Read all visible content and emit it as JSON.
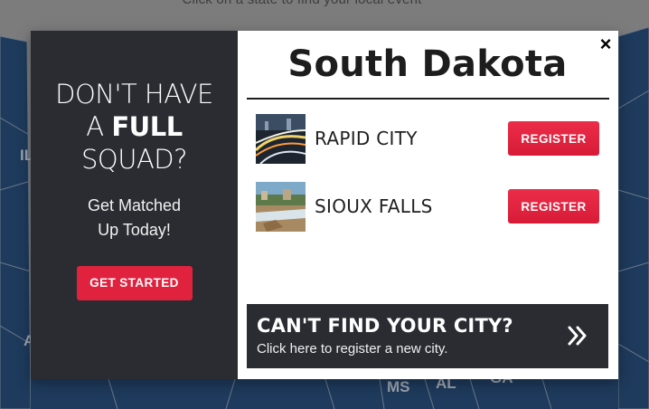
{
  "map": {
    "hint": "Click on a state to find your local event",
    "labels": [
      "IL",
      "MS",
      "AL",
      "GA",
      "A"
    ]
  },
  "promo": {
    "headline_line1": "DON'T HAVE",
    "headline_pre": "A",
    "headline_bold": "FULL",
    "headline_line3": "SQUAD?",
    "sub_line1": "Get Matched",
    "sub_line2": "Up Today!",
    "button_label": "GET STARTED"
  },
  "modal": {
    "close_label": "×",
    "state_title": "South Dakota",
    "cities": [
      {
        "name": "RAPID CITY",
        "button_label": "REGISTER",
        "thumb": "rapid-city-photo"
      },
      {
        "name": "SIOUX FALLS",
        "button_label": "REGISTER",
        "thumb": "sioux-falls-photo"
      }
    ],
    "cant_find": {
      "title": "CAN'T FIND YOUR CITY?",
      "subtitle": "Click here to register a new city.",
      "icon": "double-chevron-right-icon"
    }
  },
  "colors": {
    "map_state": "#1e3a5c",
    "dark_panel": "#2a2c32",
    "accent": "#e0223e"
  }
}
